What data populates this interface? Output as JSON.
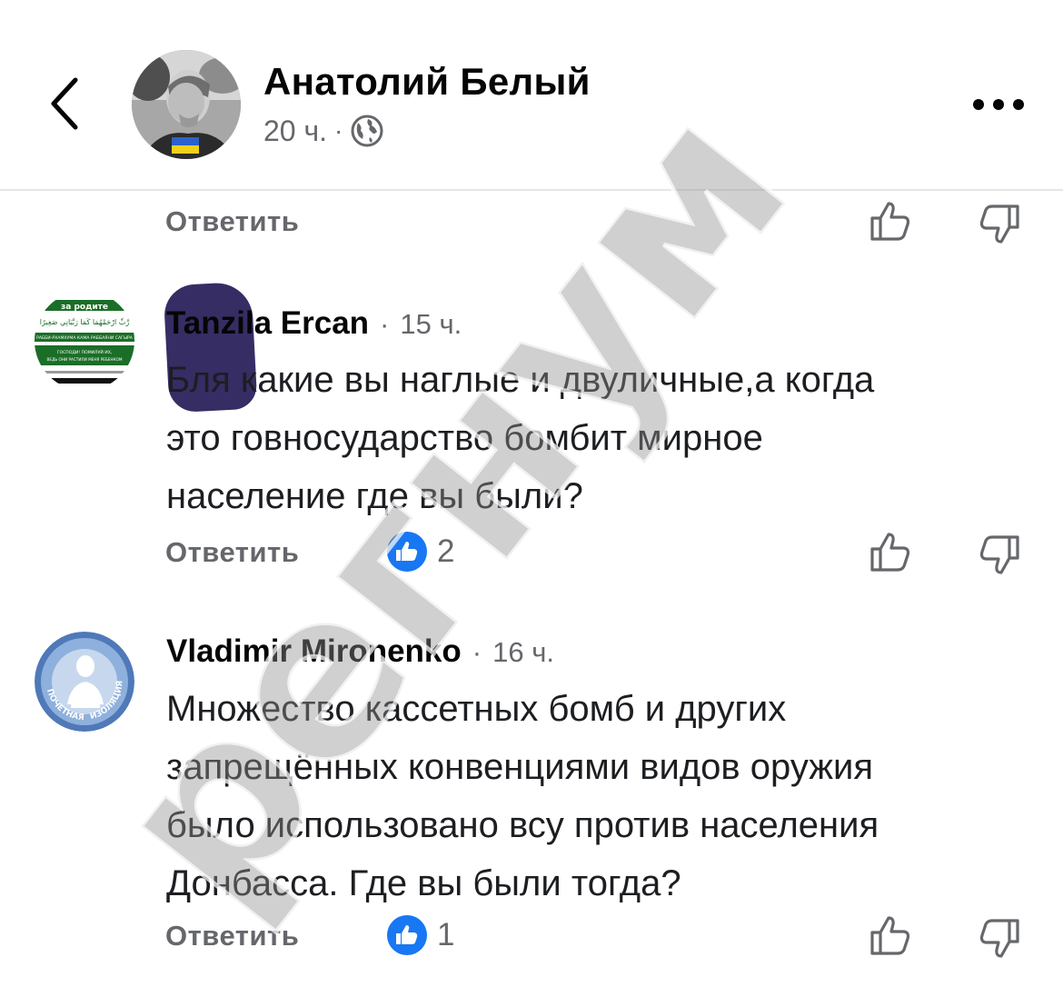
{
  "post_header": {
    "author_name": "Анатолий Белый",
    "time_ago": "20 ч.",
    "separator": "·"
  },
  "previous_comment": {
    "reply_label": "Ответить"
  },
  "comments": [
    {
      "author": "Tanzila Ercan",
      "separator": "·",
      "time_ago": "15 ч.",
      "text": "Бля какие вы наглые и двуличные,а когда\nэто говносударство бомбит мирное\nнаселение где вы были?",
      "reply_label": "Ответить",
      "likes": "2",
      "avatar_text": {
        "top": "за родите",
        "arabic": "رَّبِّ ارْحَمْهُمَا كَمَا رَبَّيَانِي صَغِيرًا",
        "line1": "РАББИ-РХАМХУМА КАМА РАББАЯНИ САГЫРА",
        "line2": "ГОСПОДИ! ПОМИЛУЙ ИХ,",
        "line3": "ВЕДЬ ОНИ РАСТИЛИ МЕНЯ РЕБЕНКОМ"
      }
    },
    {
      "author": "Vladimir Mironenko",
      "separator": "·",
      "time_ago": "16 ч.",
      "text": "Множество кассетных бомб и других\nзапрещённых конвенциями видов оружия\nбыло использовано всу против населения\nДонбасса. Где вы были тогда?",
      "reply_label": "Ответить",
      "likes": "1",
      "avatar_text": {
        "left": "ПОЧЕТНАЯ",
        "right": "ИЗОЛЯЦИЯ"
      }
    }
  ],
  "watermark": {
    "text": "регнум"
  },
  "colors": {
    "like_blue": "#1877f2",
    "meta_gray": "#65676b",
    "scribble": "#2e245e"
  }
}
